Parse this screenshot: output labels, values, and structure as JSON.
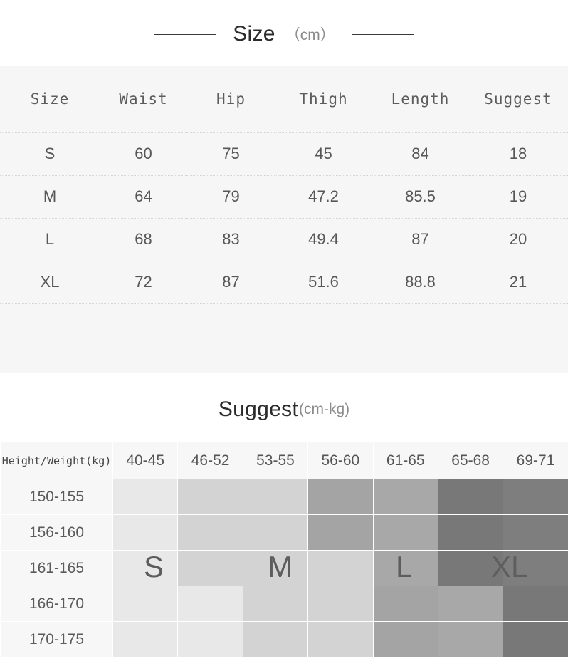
{
  "size_section": {
    "title": "Size",
    "unit": "（cm）",
    "columns": [
      "Size",
      "Waist",
      "Hip",
      "Thigh",
      "Length",
      "Suggest"
    ],
    "rows": [
      {
        "size": "S",
        "waist": "60",
        "hip": "75",
        "thigh": "45",
        "length": "84",
        "suggest": "18"
      },
      {
        "size": "M",
        "waist": "64",
        "hip": "79",
        "thigh": "47.2",
        "length": "85.5",
        "suggest": "19"
      },
      {
        "size": "L",
        "waist": "68",
        "hip": "83",
        "thigh": "49.4",
        "length": "87",
        "suggest": "20"
      },
      {
        "size": "XL",
        "waist": "72",
        "hip": "87",
        "thigh": "51.6",
        "length": "88.8",
        "suggest": "21"
      }
    ]
  },
  "suggest_section": {
    "title": "Suggest",
    "unit": "(cm-kg)",
    "corner_label": "Height/Weight(kg)",
    "weight_columns": [
      "40-45",
      "46-52",
      "53-55",
      "56-60",
      "61-65",
      "65-68",
      "69-71"
    ],
    "height_rows": [
      "150-155",
      "156-160",
      "161-165",
      "166-170",
      "170-175"
    ],
    "shade_grid": [
      [
        0,
        1,
        1,
        3,
        4,
        5,
        6
      ],
      [
        0,
        1,
        1,
        3,
        4,
        5,
        6
      ],
      [
        0,
        1,
        1,
        1,
        4,
        5,
        6
      ],
      [
        0,
        0,
        1,
        1,
        3,
        4,
        5
      ],
      [
        0,
        0,
        1,
        1,
        3,
        4,
        5
      ]
    ],
    "size_overlays": [
      {
        "label": "S",
        "column": "40-45"
      },
      {
        "label": "M",
        "column": "53-55"
      },
      {
        "label": "L",
        "column": "61-65"
      },
      {
        "label": "XL",
        "column": "65-68"
      }
    ]
  },
  "colors": {
    "page_background": "#ffffff",
    "panel_background": "#f6f6f6",
    "header_text": "#5c5c5c",
    "body_text": "#575757",
    "rule": "#3a3a3a",
    "shade_levels": [
      "#e8e8e8",
      "#d3d3d3",
      "#d3d3d3",
      "#a4a4a4",
      "#a8a8a8",
      "#787878",
      "#7e7e7e"
    ]
  }
}
